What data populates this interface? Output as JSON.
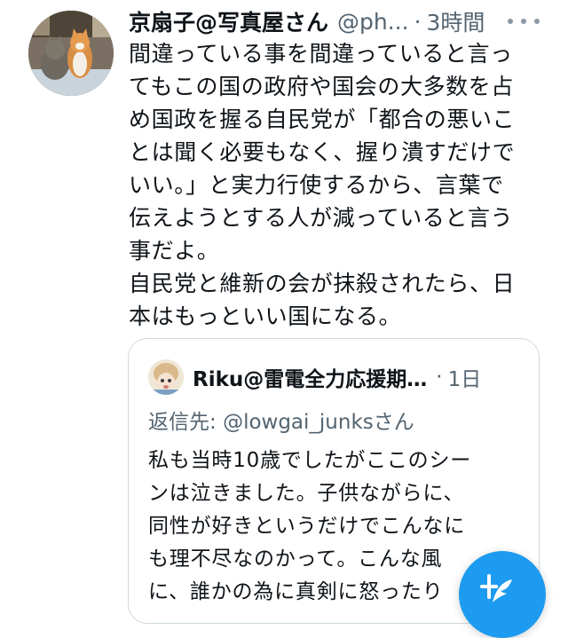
{
  "tweet": {
    "display_name": "京扇子@写真屋さん",
    "handle": "@ph...",
    "separator": "·",
    "time": "3時間",
    "body_lines": [
      "間違っている事を間違っていると言っ",
      "てもこの国の政府や国会の大多数を占",
      "め国政を握る自民党が「都合の悪いこ",
      "とは聞く必要もなく、握り潰すだけで",
      "いい。」と実力行使するから、言葉で",
      "伝えようとする人が減っていると言う",
      "事だよ。",
      "自民党と維新の会が抹殺されたら、日",
      "本はもっといい国になる。"
    ]
  },
  "quoted": {
    "display_name": "Riku@雷電全力応援期…",
    "separator": "·",
    "time": "1日",
    "reply_prefix": "返信先: ",
    "reply_handle": "@lowgai_junksさん",
    "body_lines": [
      "私も当時10歳でしたがここのシー",
      "ンは泣きました。子供ながらに、",
      "同性が好きというだけでこんなに",
      "も理不尽なのかって。こんな風",
      "に、誰かの為に真剣に怒ったり"
    ]
  },
  "icons": {
    "more": "more-horizontal-icon",
    "compose": "compose-feather-icon"
  },
  "colors": {
    "accent": "#1d9bf0",
    "text_primary": "#0f1419",
    "text_secondary": "#536471",
    "border": "#cfd9de"
  }
}
